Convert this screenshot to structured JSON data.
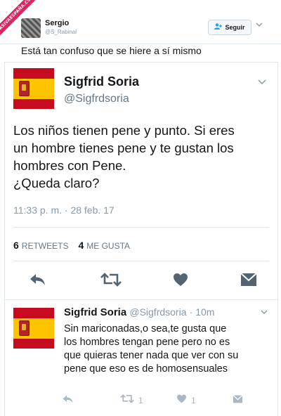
{
  "watermark": {
    "text": "ASIVAESPAÑA.COM"
  },
  "outer_tweet": {
    "author_name": "Sergio",
    "author_handle": "@S_Rabinal",
    "follow_label": "Seguir",
    "text": "Está tan confuso que se hiere a sí mismo"
  },
  "quoted_tweet": {
    "author_name": "Sigfrid Soria",
    "author_handle": "@Sigfrdsoria",
    "text_lines": [
      "Los niños tienen pene y punto. Si eres",
      "un hombre tienes pene y te gustan los",
      "hombres con Pene.",
      "¿Queda claro?"
    ],
    "timestamp": "11:33 p. m. · 28 feb. 17",
    "stats": {
      "retweets_count": "6",
      "retweets_label": "RETWEETS",
      "likes_count": "4",
      "likes_label": "ME GUSTA"
    },
    "icons": [
      "reply-icon",
      "retweet-icon",
      "heart-icon",
      "message-icon"
    ]
  },
  "reply_tweet": {
    "author_name": "Sigfrid Soria",
    "author_handle": "@Sigfrdsoria",
    "time": "· 10m",
    "text_lines": [
      "Sin mariconadas,o sea,te gusta que",
      "los hombres tengan pene pero no es",
      "que quieras tener nada que ver con su",
      "pene que eso es de homosensuales"
    ],
    "retweet_count": "1",
    "like_count": "1"
  },
  "colors": {
    "icon_dark": "#536471",
    "icon_light": "#aab8c2",
    "link_blue": "#1da1f2",
    "flag_red": "#c60b1e",
    "flag_yellow": "#ffc400"
  }
}
